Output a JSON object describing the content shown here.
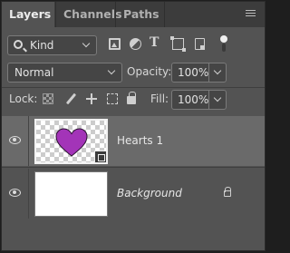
{
  "tabs": [
    {
      "label": "Layers",
      "active": true
    },
    {
      "label": "Channels",
      "active": false
    },
    {
      "label": "Paths",
      "active": false
    }
  ],
  "filter": {
    "kind_label": "Kind",
    "icons": [
      "image-filter-icon",
      "adjustment-filter-icon",
      "type-filter-icon",
      "shape-filter-icon",
      "smart-object-filter-icon",
      "filter-toggle-icon"
    ]
  },
  "blend": {
    "mode": "Normal",
    "opacity_label": "Opacity:",
    "opacity_value": "100%"
  },
  "lock": {
    "label": "Lock:",
    "icons": [
      "lock-pixels-icon",
      "lock-image-pixels-icon",
      "lock-position-icon",
      "lock-artboard-icon",
      "lock-all-icon"
    ],
    "fill_label": "Fill:",
    "fill_value": "100%"
  },
  "layers": [
    {
      "name": "Hearts 1",
      "selected": true,
      "visible": true,
      "type": "smart-object"
    },
    {
      "name": "Background",
      "selected": false,
      "visible": true,
      "locked": true
    }
  ],
  "colors": {
    "panel": "#535353",
    "tab_bar": "#3c3c3c",
    "selected_layer": "#6a6a6a",
    "heart": "#a334b8"
  }
}
